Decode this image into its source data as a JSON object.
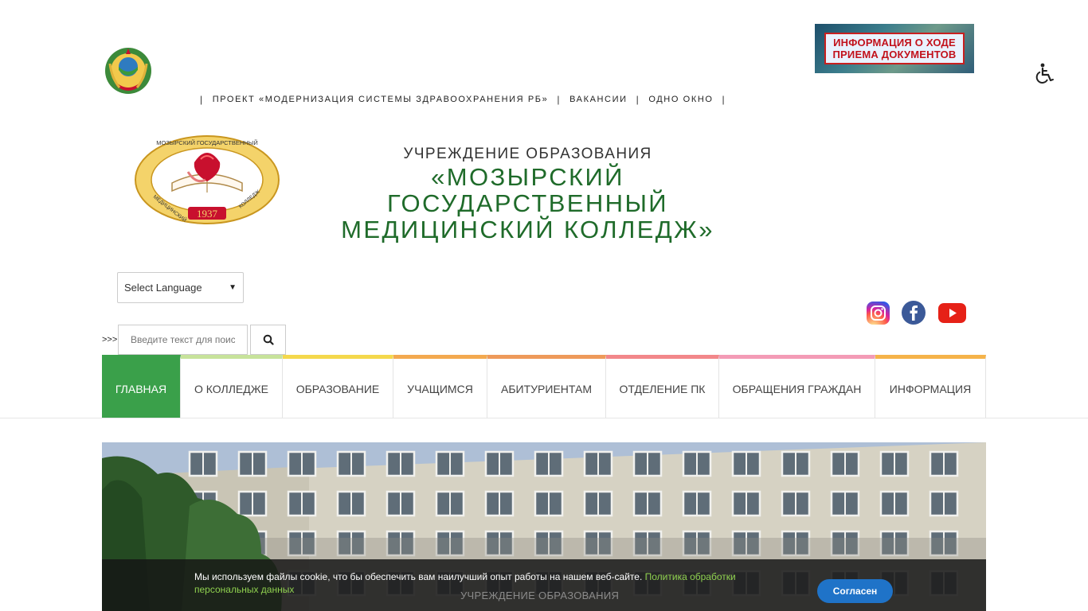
{
  "top_nav": {
    "items": [
      {
        "label": "ПРОЕКТ «МОДЕРНИЗАЦИЯ СИСТЕМЫ ЗДРАВООХРАНЕНИЯ РБ»"
      },
      {
        "label": "ВАКАНСИИ"
      },
      {
        "label": "ОДНО ОКНО"
      }
    ],
    "separator": "|"
  },
  "banner": {
    "line1": "ИНФОРМАЦИЯ О ХОДЕ",
    "line2": "ПРИЕМА ДОКУМЕНТОВ"
  },
  "header": {
    "subtitle": "УЧРЕЖДЕНИЕ ОБРАЗОВАНИЯ",
    "title_line1": "«МОЗЫРСКИЙ ГОСУДАРСТВЕННЫЙ",
    "title_line2": "МЕДИЦИНСКИЙ КОЛЛЕДЖ»",
    "logo_text_top": "МОЗЫРСКИЙ ГОСУДАРСТВЕННЫЙ",
    "logo_text_left": "МЕДИЦИНСКИЙ",
    "logo_text_right": "КОЛЛЕДЖ",
    "logo_year": "1937"
  },
  "language": {
    "selected": "Select Language"
  },
  "search": {
    "prefix": ">>>",
    "placeholder": "Введите текст для поиск"
  },
  "social": [
    "instagram-icon",
    "facebook-icon",
    "youtube-icon"
  ],
  "main_nav": {
    "items": [
      {
        "label": "ГЛАВНАЯ",
        "color": "#3aa04a"
      },
      {
        "label": "О КОЛЛЕДЖЕ",
        "color": "#c7e39b"
      },
      {
        "label": "ОБРАЗОВАНИЕ",
        "color": "#f4d84c"
      },
      {
        "label": "УЧАЩИМСЯ",
        "color": "#f3a94f"
      },
      {
        "label": "АБИТУРИЕНТАМ",
        "color": "#ee9a5a"
      },
      {
        "label": "ОТДЕЛЕНИЕ ПК",
        "color": "#f2878a"
      },
      {
        "label": "ОБРАЩЕНИЯ ГРАЖДАН",
        "color": "#f39bb6"
      },
      {
        "label": "ИНФОРМАЦИЯ",
        "color": "#f5b34a"
      }
    ]
  },
  "hero": {
    "overlay_text": "УЧРЕЖДЕНИЕ ОБРАЗОВАНИЯ"
  },
  "cookie": {
    "text": "Мы используем файлы cookie, что бы обеспечить вам наилучший опыт работы на нашем веб-сайте.",
    "link": "Политика обработки персональных данных",
    "button": "Согласен"
  },
  "colors": {
    "brand_green": "#1f6b2a",
    "active_green": "#3aa04a",
    "cookie_link": "#8fd14f",
    "button_blue": "#1f73c8"
  }
}
